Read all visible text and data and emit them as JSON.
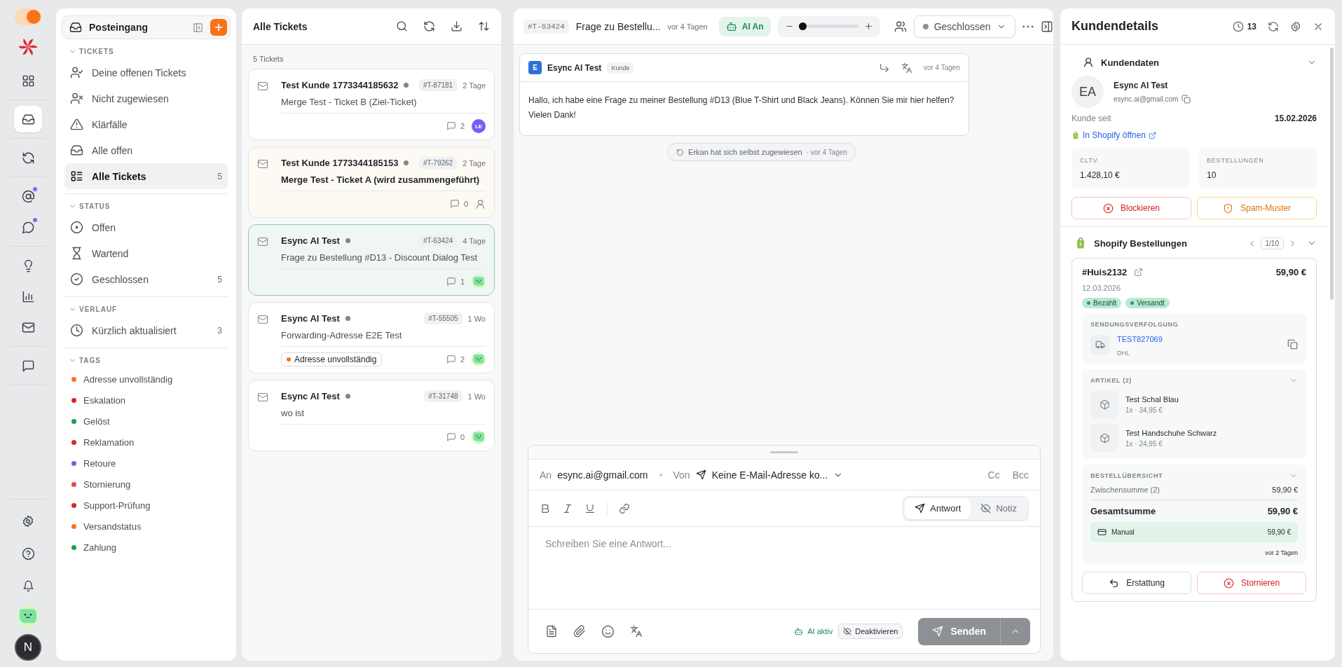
{
  "rail": {
    "toggle": {
      "on": true
    },
    "groups": [
      [
        {
          "selected": false,
          "unread": false
        }
      ],
      [
        {
          "selected": true,
          "unread": false
        }
      ],
      [
        {
          "selected": false,
          "unread": false
        }
      ],
      [
        {
          "selected": false,
          "unread": true
        },
        {
          "selected": false,
          "unread": true
        }
      ],
      [
        {
          "selected": false,
          "unread": false
        },
        {
          "selected": false,
          "unread": false
        },
        {
          "selected": false,
          "unread": false
        }
      ],
      [
        {
          "selected": false,
          "unread": false
        }
      ]
    ],
    "user_initial": "N"
  },
  "nav": {
    "title": "Posteingang",
    "sections": [
      {
        "kind": "menu",
        "title": "TICKETS",
        "expanded": true,
        "items": [
          {
            "label": "Deine offenen Tickets",
            "selected": false
          },
          {
            "label": "Nicht zugewiesen",
            "selected": false
          },
          {
            "label": "Klärfälle",
            "selected": false
          },
          {
            "label": "Alle offen",
            "selected": false
          },
          {
            "label": "Alle Tickets",
            "count": "5",
            "selected": true
          }
        ]
      },
      {
        "kind": "menu",
        "title": "STATUS",
        "expanded": true,
        "items": [
          {
            "label": "Offen",
            "selected": false
          },
          {
            "label": "Wartend",
            "selected": false
          },
          {
            "label": "Geschlossen",
            "count": "5",
            "selected": false
          }
        ]
      },
      {
        "kind": "menu",
        "title": "VERLAUF",
        "expanded": true,
        "items": [
          {
            "label": "Kürzlich aktualisiert",
            "count": "3",
            "selected": false
          }
        ]
      },
      {
        "kind": "tags",
        "title": "TAGS",
        "expanded": true,
        "items": [
          {
            "label": "Adresse unvollständig",
            "color": "#f97316",
            "selected": false
          },
          {
            "label": "Eskalation",
            "color": "#dc2626",
            "selected": false
          },
          {
            "label": "Gelöst",
            "color": "#16a34a",
            "selected": false
          },
          {
            "label": "Reklamation",
            "color": "#dc2626",
            "selected": false
          },
          {
            "label": "Retoure",
            "color": "#7c5cf0",
            "selected": false
          },
          {
            "label": "Stornierung",
            "color": "#e5484d",
            "selected": false
          },
          {
            "label": "Support-Prüfung",
            "color": "#dc2626",
            "selected": false
          },
          {
            "label": "Versandstatus",
            "color": "#f97316",
            "selected": false
          },
          {
            "label": "Zahlung",
            "color": "#16a34a",
            "selected": false
          }
        ]
      }
    ]
  },
  "ticket_list": {
    "title": "Alle Tickets",
    "count": "5 Tickets",
    "tickets": [
      {
        "sender": "Test Kunde 1773344185632",
        "id": "#T-87181",
        "age": "2 Tage",
        "subject": "Merge Test - Ticket B (Ziel-Ticket)",
        "comments": "2",
        "assignee": {
          "kind": "initials",
          "text": "LE"
        },
        "unread": false,
        "selected": false
      },
      {
        "sender": "Test Kunde 1773344185153",
        "id": "#T-79262",
        "age": "2 Tage",
        "subject": "Merge Test - Ticket A (wird zusammengeführt)",
        "comments": "0",
        "assignee": {
          "kind": "none"
        },
        "unread": true,
        "selected": false
      },
      {
        "sender": "Esync AI Test",
        "id": "#T-63424",
        "age": "4 Tage",
        "subject": "Frage zu Bestellung #D13 - Discount Dialog Test",
        "comments": "1",
        "assignee": {
          "kind": "avatar"
        },
        "unread": false,
        "selected": true
      },
      {
        "sender": "Esync AI Test",
        "id": "#T-55505",
        "age": "1 Wo",
        "subject": "Forwarding-Adresse E2E Test",
        "comments": "2",
        "assignee": {
          "kind": "avatar"
        },
        "unread": false,
        "selected": false,
        "tags": [
          {
            "label": "Adresse unvollständig",
            "color": "#f97316"
          }
        ]
      },
      {
        "sender": "Esync AI Test",
        "id": "#T-31748",
        "age": "1 Wo",
        "subject": "wo ist",
        "comments": "0",
        "assignee": {
          "kind": "avatar"
        },
        "unread": false,
        "selected": false
      }
    ]
  },
  "conversation": {
    "id": "#T-63424",
    "title": "Frage zu Bestellu...",
    "time": "vor 4 Tagen",
    "ai_toggle": {
      "label": "AI An",
      "on": true
    },
    "zoom": {
      "level": 0.05
    },
    "status": "Geschlossen",
    "message": {
      "initial": "E",
      "sender": "Esync AI Test",
      "role": "Kunde",
      "time": "vor 4 Tagen",
      "body": "Hallo, ich habe eine Frage zu meiner Bestellung #D13 (Blue T-Shirt und Black Jeans). Können Sie mir hier helfen? Vielen Dank!"
    },
    "event": {
      "text": "Erkan hat sich selbst zugewiesen",
      "time": "· vor 4 Tagen"
    },
    "composer": {
      "to_label": "An",
      "to": "esync.ai@gmail.com",
      "from_label": "Von",
      "from": "Keine E-Mail-Adresse ko...",
      "cc": "Cc",
      "bcc": "Bcc",
      "modes": [
        {
          "kind": "reply",
          "label": "Antwort",
          "selected": true
        },
        {
          "kind": "note",
          "label": "Notiz",
          "selected": false
        }
      ],
      "placeholder": "Schreiben Sie eine Antwort...",
      "ai_status": "AI aktiv",
      "deactivate": "Deaktivieren",
      "send": {
        "label": "Senden",
        "disabled": true
      }
    }
  },
  "customer": {
    "title": "Kundendetails",
    "history_count": "13",
    "profile": {
      "title": "Kundendaten",
      "expanded": true,
      "initials": "EA",
      "name": "Esync AI Test",
      "email": "esync.ai@gmail.com",
      "since_label": "Kunde seit",
      "since": "15.02.2026",
      "shopify_link": "In Shopify öffnen",
      "stats": [
        {
          "label": "CLTV",
          "value": "1.428,10 €"
        },
        {
          "label": "BESTELLUNGEN",
          "value": "10"
        }
      ],
      "actions": [
        {
          "kind": "danger",
          "label": "Blockieren"
        },
        {
          "kind": "warning",
          "label": "Spam-Muster"
        }
      ]
    },
    "orders": {
      "title": "Shopify Bestellungen",
      "pager": "1/10",
      "expanded": true,
      "order": {
        "number": "#Huis2132",
        "total": "59,90 €",
        "date": "12.03.2026",
        "badges": [
          "Bezahlt",
          "Versandt"
        ],
        "tracking": {
          "title": "SENDUNGSVERFOLGUNG",
          "number": "TEST827069",
          "carrier": "DHL"
        },
        "items_title": "ARTIKEL (2)",
        "items": [
          {
            "name": "Test Schal Blau",
            "detail": "1x · 34,95 €"
          },
          {
            "name": "Test Handschuhe Schwarz",
            "detail": "1x · 24,95 €"
          }
        ],
        "summary": {
          "title": "BESTELLÜBERSICHT",
          "subtotal_label": "Zwischensumme (2)",
          "subtotal": "59,90 €",
          "total_label": "Gesamtsumme",
          "total": "59,90 €",
          "payment_method": "Manual",
          "payment_amount": "59,90 €",
          "time": "vor 2 Tagen"
        },
        "actions": [
          {
            "kind": "neutral",
            "label": "Erstattung"
          },
          {
            "kind": "danger",
            "label": "Stornieren"
          }
        ]
      }
    }
  }
}
